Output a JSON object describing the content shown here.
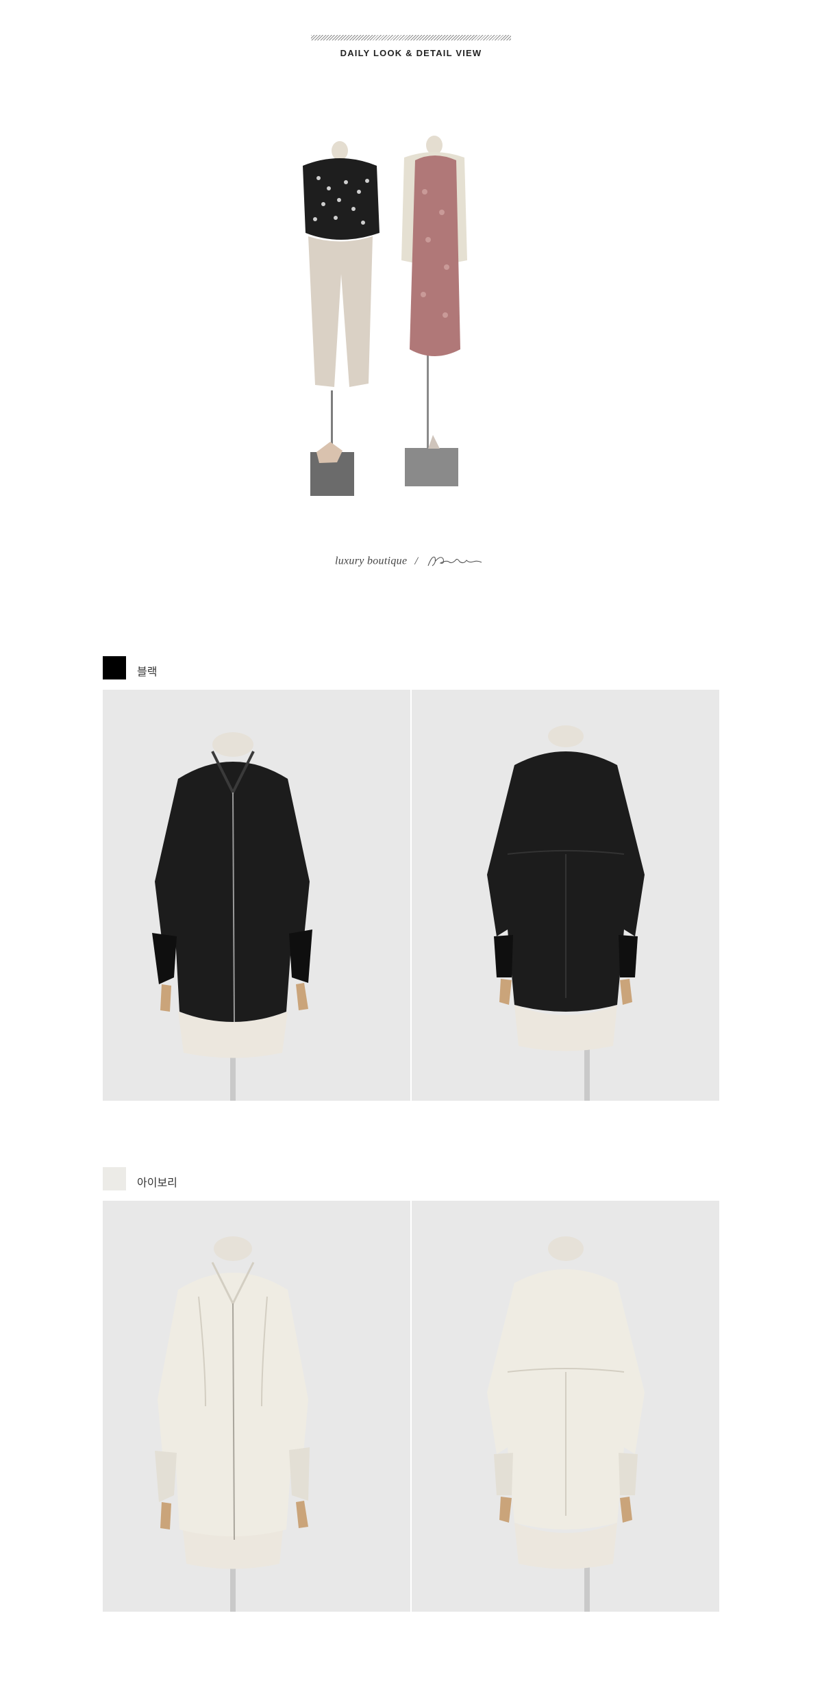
{
  "header": {
    "title": "DAILY LOOK & DETAIL VIEW"
  },
  "brand": {
    "tagline": "luxury boutique",
    "separator": "/",
    "logo_icon": "jblanc-script-logo"
  },
  "colors": [
    {
      "name": "블랙",
      "swatch": "#000000",
      "jacket": "#1c1c1c",
      "jacket_shade": "#0b0b0b",
      "bg": "#e9e9e9"
    },
    {
      "name": "아이보리",
      "swatch": "#ecebe7",
      "jacket": "#efece3",
      "jacket_shade": "#d9d5ca",
      "bg": "#e9e9e9"
    }
  ],
  "views": [
    "front",
    "back"
  ]
}
